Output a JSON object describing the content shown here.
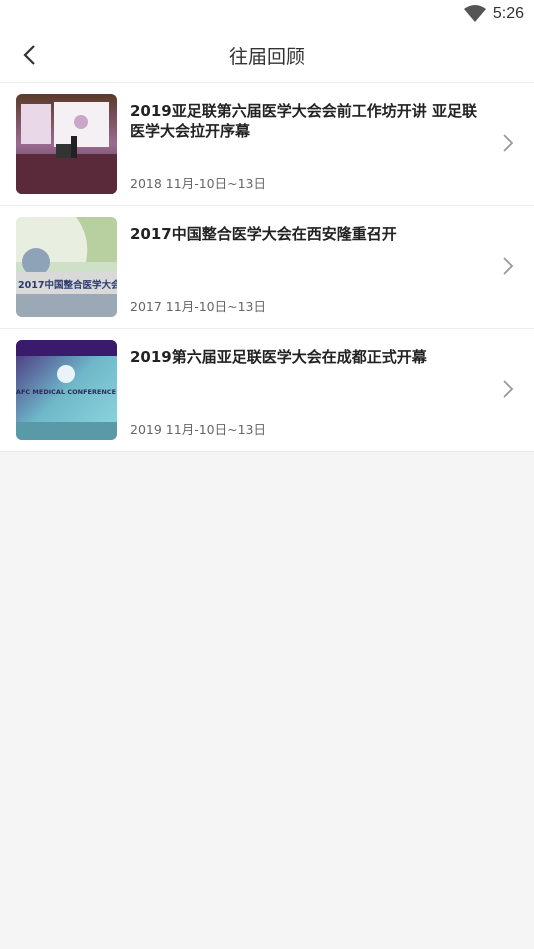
{
  "status_bar": {
    "time": "5:26"
  },
  "nav": {
    "title": "往届回顾"
  },
  "items": [
    {
      "title": "2019亚足联第六届医学大会会前工作坊开讲 亚足联医学大会拉开序幕",
      "date": "2018 11月-10日~13日"
    },
    {
      "title": "2017中国整合医学大会在西安隆重召开",
      "date": "2017 11月-10日~13日",
      "thumb_text": "2017中国整合医学大会"
    },
    {
      "title": "2019第六届亚足联医学大会在成都正式开幕",
      "date": "2019 11月-10日~13日",
      "thumb_text": "AFC MEDICAL CONFERENCE"
    }
  ]
}
